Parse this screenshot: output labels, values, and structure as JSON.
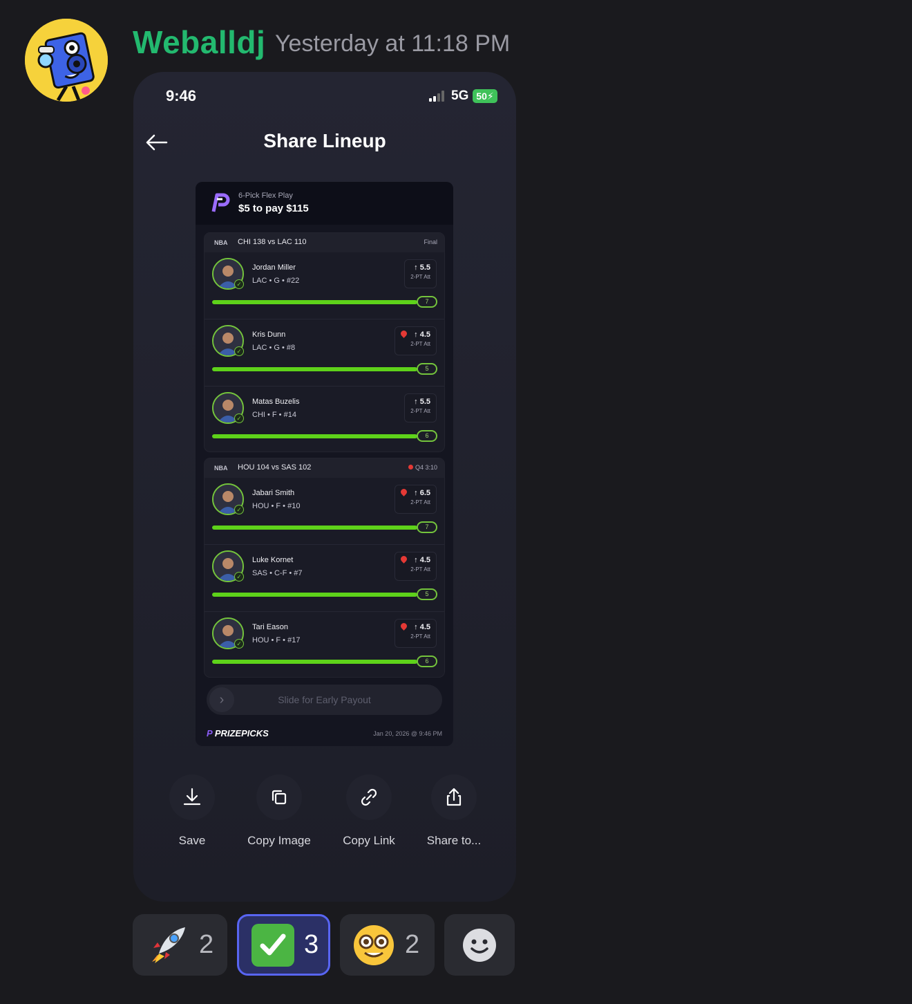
{
  "message": {
    "username": "Weballdj",
    "timestamp": "Yesterday at 11:18 PM"
  },
  "phone": {
    "status_time": "9:46",
    "network": "5G",
    "battery": "50",
    "screen_title": "Share Lineup"
  },
  "card": {
    "play_type": "6-Pick Flex Play",
    "payout": "$5 to pay $115",
    "groups": [
      {
        "league": "NBA",
        "score": "CHI 138 vs LAC 110",
        "status": "Final",
        "live": false,
        "picks": [
          {
            "name": "Jordan Miller",
            "team": "LAC • G • #22",
            "line": "5.5",
            "stat": "2-PT Att",
            "actual": "7",
            "hot": false
          },
          {
            "name": "Kris Dunn",
            "team": "LAC • G • #8",
            "line": "4.5",
            "stat": "2-PT Att",
            "actual": "5",
            "hot": true
          },
          {
            "name": "Matas Buzelis",
            "team": "CHI • F • #14",
            "line": "5.5",
            "stat": "2-PT Att",
            "actual": "6",
            "hot": false
          }
        ]
      },
      {
        "league": "NBA",
        "score": "HOU 104 vs SAS 102",
        "status": "Q4 3:10",
        "live": true,
        "picks": [
          {
            "name": "Jabari Smith",
            "team": "HOU • F • #10",
            "line": "6.5",
            "stat": "2-PT Att",
            "actual": "7",
            "hot": true
          },
          {
            "name": "Luke Kornet",
            "team": "SAS • C-F • #7",
            "line": "4.5",
            "stat": "2-PT Att",
            "actual": "5",
            "hot": true
          },
          {
            "name": "Tari Eason",
            "team": "HOU • F • #17",
            "line": "4.5",
            "stat": "2-PT Att",
            "actual": "6",
            "hot": true
          }
        ]
      }
    ],
    "slider_text": "Slide for Early Payout",
    "brand": "PRIZEPICKS",
    "date": "Jan 20, 2026 @ 9:46 PM"
  },
  "actions": [
    {
      "label": "Save",
      "icon": "download-icon"
    },
    {
      "label": "Copy Image",
      "icon": "copy-icon"
    },
    {
      "label": "Copy Link",
      "icon": "link-icon"
    },
    {
      "label": "Share to...",
      "icon": "share-icon"
    }
  ],
  "reactions": [
    {
      "emoji": "rocket",
      "count": "2",
      "active": false
    },
    {
      "emoji": "white-check-mark",
      "count": "3",
      "active": true
    },
    {
      "emoji": "nerd-face",
      "count": "2",
      "active": false
    },
    {
      "emoji": "add-reaction",
      "count": "",
      "active": false
    }
  ],
  "colors": {
    "username": "#23b96f",
    "progress": "#5ed21a",
    "active_reaction_border": "#5865f2",
    "check_green": "#4bb543"
  }
}
